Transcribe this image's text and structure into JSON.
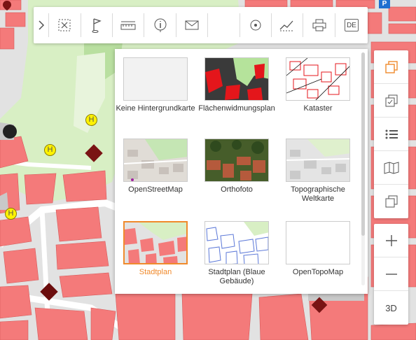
{
  "toolbar": {
    "buttons": [
      {
        "icon": "chevron-right-icon"
      },
      {
        "icon": "select-area-icon"
      },
      {
        "icon": "flag-icon"
      },
      {
        "icon": "measure-icon"
      },
      {
        "icon": "info-icon"
      },
      {
        "icon": "mail-icon"
      },
      {
        "icon": "search-location-icon"
      },
      {
        "icon": "elevation-profile-icon"
      },
      {
        "icon": "print-icon"
      }
    ],
    "language": "DE"
  },
  "basemaps": [
    {
      "label": "Keine Hintergrundkarte",
      "active": false
    },
    {
      "label": "Flächenwidmungsplan",
      "active": false
    },
    {
      "label": "Kataster",
      "active": false
    },
    {
      "label": "OpenStreetMap",
      "active": false
    },
    {
      "label": "Orthofoto",
      "active": false
    },
    {
      "label": "Topographische Weltkarte",
      "active": false
    },
    {
      "label": "Stadtplan",
      "active": true
    },
    {
      "label": "Stadtplan (Blaue Gebäude)",
      "active": false
    },
    {
      "label": "OpenTopoMap",
      "active": false
    }
  ],
  "right_toolbar": {
    "buttons": [
      "layers-icon",
      "compare-icon",
      "list-icon",
      "map-book-icon",
      "copy-icon"
    ],
    "zoom": [
      "zoom-in-icon",
      "zoom-out-icon"
    ],
    "view_toggle": "3D"
  },
  "map": {
    "markers": [
      "H",
      "H",
      "H"
    ],
    "parking": "P"
  },
  "colors": {
    "accent": "#f08a2c",
    "building": "#f47a7a",
    "park": "#d5eec0",
    "road": "#ffffff"
  }
}
